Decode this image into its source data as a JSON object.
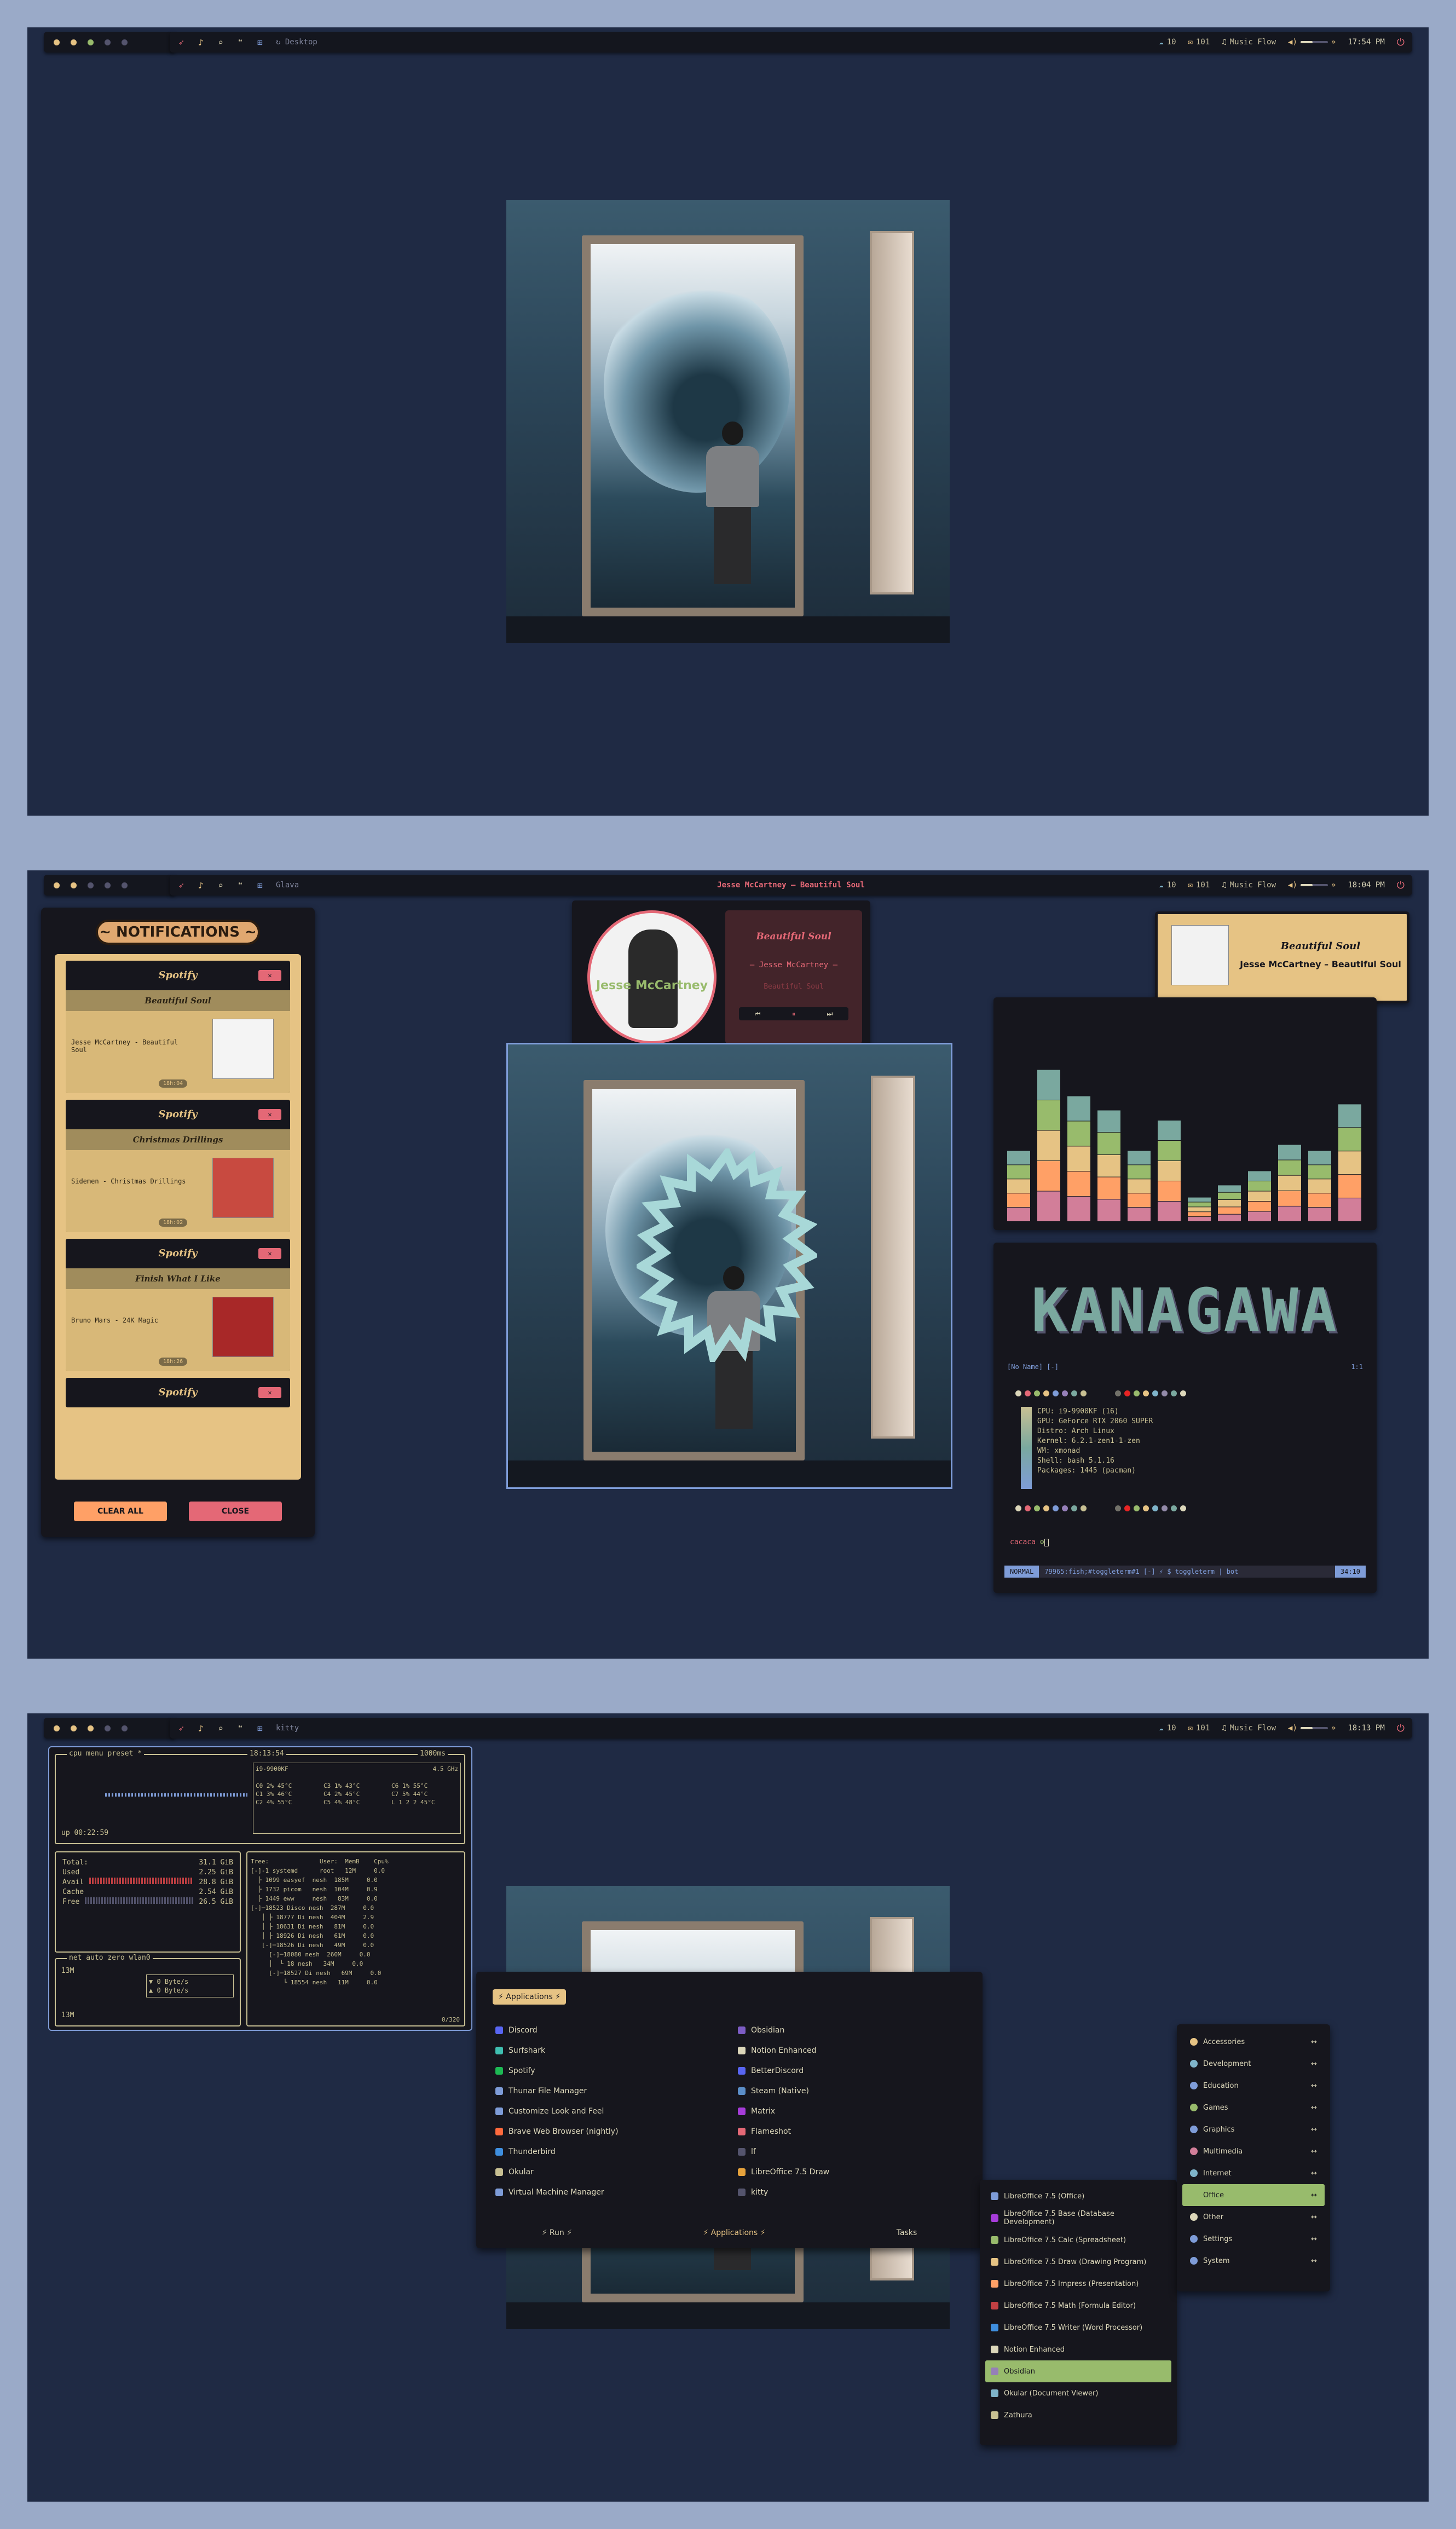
{
  "colors": {
    "accent": "#e46876",
    "yellow": "#e6c384",
    "green": "#98bb6c",
    "bg": "#1f2a44",
    "bar": "#14161e"
  },
  "bar": {
    "net": "10",
    "mail": "101",
    "music": "Music Flow",
    "icons": [
      "rocket-icon",
      "bell-icon",
      "search-icon",
      "quote-icon",
      "grid-icon"
    ]
  },
  "screens": [
    {
      "window": "↻ Desktop",
      "time": "17:54 PM"
    },
    {
      "window": "Glava",
      "time": "18:04 PM",
      "now_playing": "Jesse McCartney – Beautiful Soul"
    },
    {
      "window": "kitty",
      "time": "18:13 PM"
    }
  ],
  "notifications": {
    "title": "~ NOTIFICATIONS ~",
    "items": [
      {
        "app": "Spotify",
        "song": "Beautiful Soul",
        "text": "Jesse McCartney - Beautiful Soul",
        "time": "18h:04"
      },
      {
        "app": "Spotify",
        "song": "Christmas Drillings",
        "text": "Sidemen - Christmas Drillings",
        "time": "18h:02"
      },
      {
        "app": "Spotify",
        "song": "Finish What I Like",
        "text": "Bruno Mars - 24K Magic",
        "time": "18h:26"
      },
      {
        "app": "Spotify"
      }
    ],
    "clear_label": "CLEAR ALL",
    "close_label": "CLOSE"
  },
  "player": {
    "song": "Beautiful Soul",
    "artist": "– Jesse McCartney –",
    "album": "Beautiful Soul",
    "cover_text": "Jesse McCartney"
  },
  "popup": {
    "title": "Beautiful Soul",
    "artist": "Jesse McCartney – Beautiful Soul"
  },
  "visualizer": {
    "levels": [
      0.35,
      0.75,
      0.62,
      0.55,
      0.35,
      0.5,
      0.12,
      0.18,
      0.25,
      0.38,
      0.35,
      0.58
    ]
  },
  "terminal": {
    "logo": "KANAGAWA",
    "header_left": "[No Name] [-]",
    "header_right": "1:1",
    "info": [
      "CPU: i9-9900KF (16)",
      "GPU: GeForce RTX 2060 SUPER",
      "Distro: Arch Linux",
      "Kernel: 6.2.1-zen1-1-zen",
      "WM: xmonad",
      "Shell: bash 5.1.16",
      "Packages: 1445 (pacman)"
    ],
    "prompt": "cacaca",
    "status_mode": "NORMAL",
    "status_text": "79965:fish;#toggleterm#1 [-]   ⚡  $ toggleterm | bot",
    "status_pos": "34:10"
  },
  "btop": {
    "cpu_title": "cpu menu preset *",
    "time": "18:13:54",
    "ms": "1000ms",
    "model": "i9-9900KF",
    "ghz": "4.5 GHz",
    "uptime": "up 00:22:59",
    "cores": [
      "C0  2%  45°C",
      "C1  3%  46°C",
      "C2  4%  55°C",
      "C3  1%  43°C",
      "C4  2%  45°C",
      "C5  4%  48°C",
      "C6  1%  55°C",
      "C7  5%  44°C",
      "L 1 2 2  45°C"
    ],
    "mem": [
      {
        "k": "Total:",
        "v": "31.1 GiB"
      },
      {
        "k": "Used",
        "v": "2.25 GiB"
      },
      {
        "k": "Avail",
        "v": "28.8 GiB"
      },
      {
        "k": "Cache",
        "v": "2.54 GiB"
      },
      {
        "k": "Free",
        "v": "26.5 GiB"
      }
    ],
    "net": {
      "title": "net auto zero wlan0",
      "top": "13M",
      "bottom": "13M",
      "down": "▼ 0 Byte/s",
      "up": "▲ 0 Byte/s"
    },
    "proc_head": "Tree:              User:  MemB    Cpu%",
    "procs": [
      "[-]-1 systemd      root   12M     0.0",
      "  ├ 1099 easyef  nesh  185M     0.0",
      "  ├ 1732 picom   nesh  104M     0.9",
      "  ├ 1449 eww     nesh   83M     0.0",
      "[-]─18523 Disco nesh  287M     0.0",
      "   │ ├ 18777 Di nesh  404M     2.9",
      "   │ ├ 18631 Di nesh   81M     0.0",
      "   │ ├ 18926 Di nesh   61M     0.0",
      "   [-]─18526 Di nesh   49M     0.0",
      "     [-]─18080 nesh  260M     0.0",
      "     │  └ 18 nesh   34M     0.0",
      "     [-]─18527 Di nesh   69M     0.0",
      "         └ 18554 nesh   11M     0.0"
    ],
    "proc_count": "0/320"
  },
  "launcher": {
    "title": "⚡ Applications ⚡",
    "left": [
      "Discord",
      "Surfshark",
      "Spotify",
      "Thunar File Manager",
      "Customize Look and Feel",
      "Brave Web Browser (nightly)",
      "Thunderbird",
      "Okular",
      "Virtual Machine Manager"
    ],
    "right": [
      "Obsidian",
      "Notion Enhanced",
      "BetterDiscord",
      "Steam (Native)",
      "Matrix",
      "Flameshot",
      "lf",
      "LibreOffice 7.5 Draw",
      "kitty"
    ],
    "tabs": [
      "⚡ Run ⚡",
      "⚡ Applications ⚡",
      "Tasks"
    ]
  },
  "submenu": [
    "LibreOffice 7.5 (Office)",
    "LibreOffice 7.5 Base (Database Development)",
    "LibreOffice 7.5 Calc (Spreadsheet)",
    "LibreOffice 7.5 Draw (Drawing Program)",
    "LibreOffice 7.5 Impress (Presentation)",
    "LibreOffice 7.5 Math (Formula Editor)",
    "LibreOffice 7.5 Writer (Word Processor)",
    "Notion Enhanced",
    "Obsidian",
    "Okular (Document Viewer)",
    "Zathura"
  ],
  "submenu_active": 8,
  "categories": [
    "Accessories",
    "Development",
    "Education",
    "Games",
    "Graphics",
    "Multimedia",
    "Internet",
    "Office",
    "Other",
    "Settings",
    "System"
  ],
  "categories_active": 7
}
